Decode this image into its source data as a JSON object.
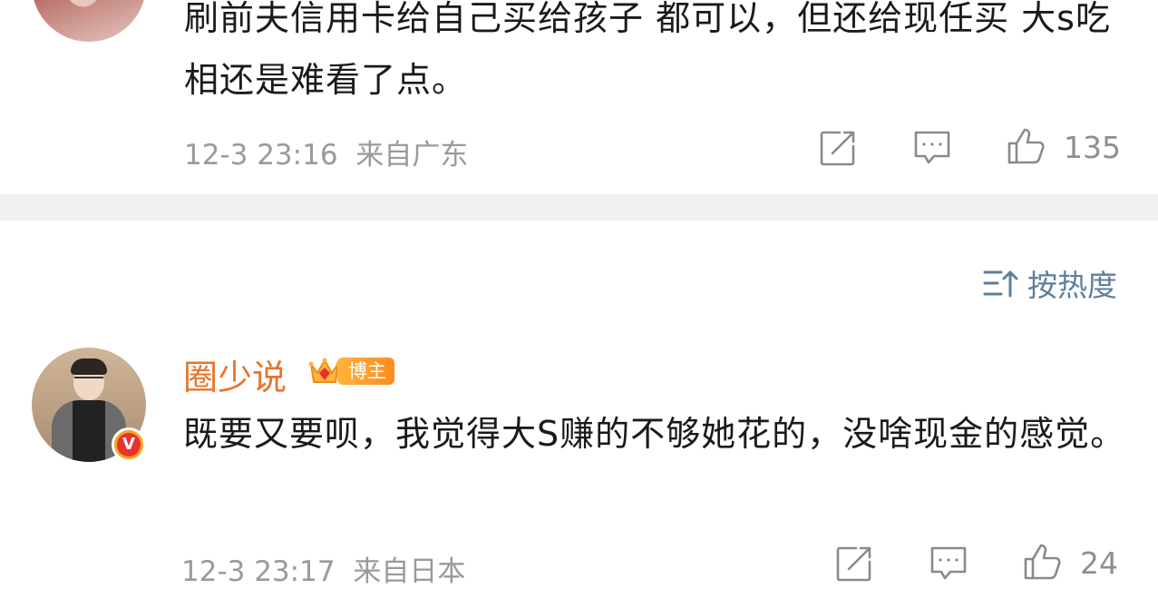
{
  "comment_top": {
    "text": "刷前夫信用卡给自己买给孩子 都可以，但还给现任买 大s吃相还是难看了点。",
    "time": "12-3 23:16",
    "location": "来自广东",
    "likes": "135",
    "icons": {
      "repost": "repost-icon",
      "reply": "comment-icon",
      "like": "thumbs-up-icon"
    }
  },
  "sort": {
    "label": "按热度",
    "icon": "sort-icon"
  },
  "comment2": {
    "username": "圈少说",
    "badge_label": "博主",
    "text": "既要又要呗，我觉得大S赚的不够她花的，没啥现金的感觉。",
    "time": "12-3 23:17",
    "location": "来自日本",
    "likes": "24",
    "verified_mark": "V",
    "icons": {
      "repost": "repost-icon",
      "reply": "comment-icon",
      "like": "thumbs-up-icon"
    }
  },
  "colors": {
    "username": "#e8742b",
    "sort": "#5d7f9e",
    "meta": "#9a9a9a",
    "divider": "#f1f1f1",
    "badge": "#ff8a1e"
  }
}
